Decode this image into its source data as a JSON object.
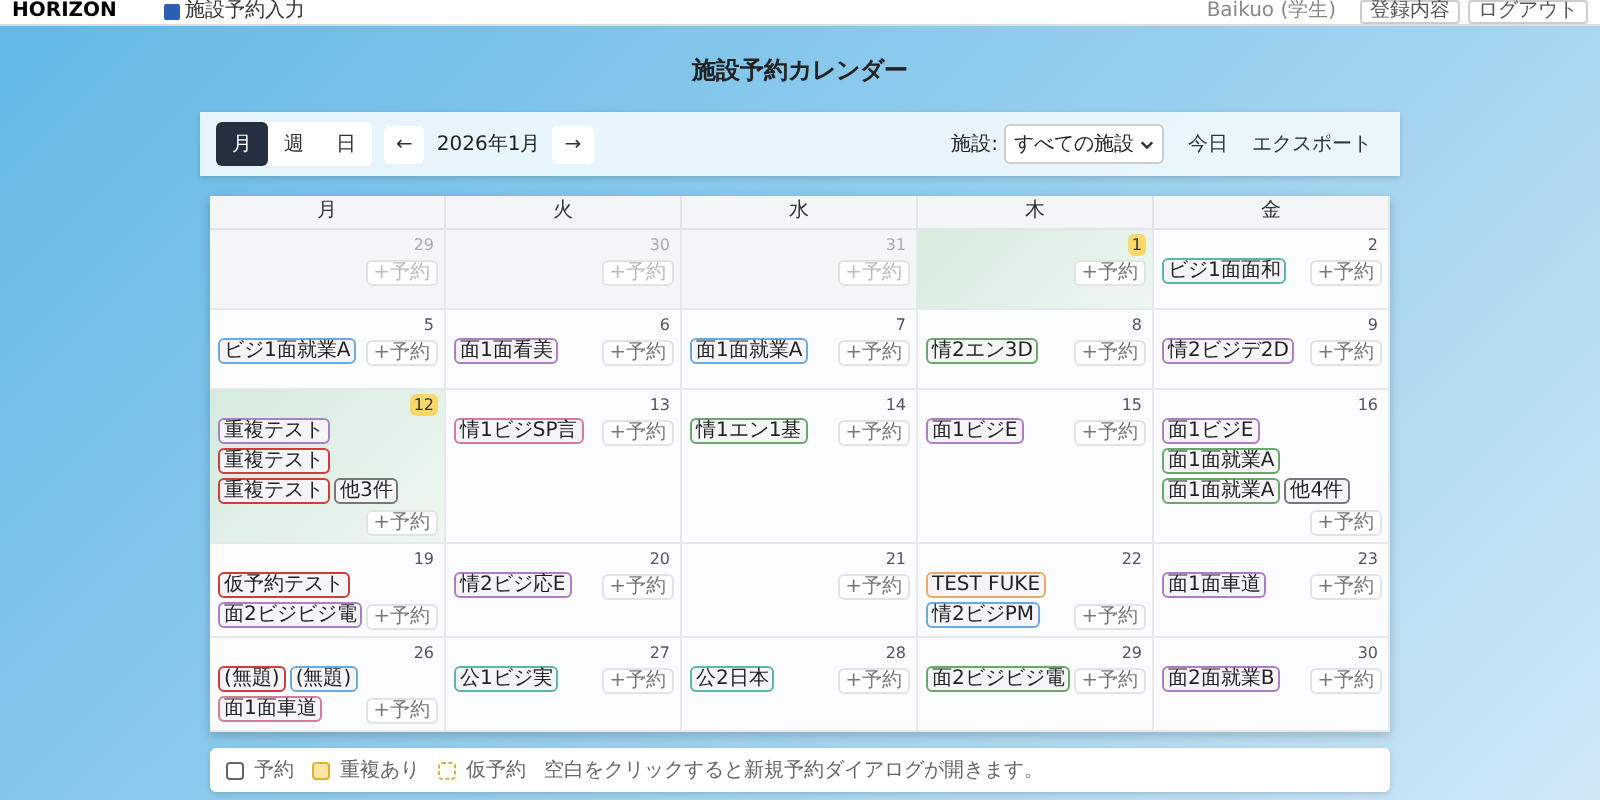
{
  "header": {
    "logo": "HORIZON",
    "nav": "施設予約入力",
    "user": "Baikuo (学生)",
    "buttons": [
      "登録内容",
      "ログアウト"
    ]
  },
  "title": "施設予約カレンダー",
  "toolbar": {
    "views": [
      {
        "label": "月",
        "selected": true
      },
      {
        "label": "週",
        "selected": false
      },
      {
        "label": "日",
        "selected": false
      }
    ],
    "prev": "←",
    "month": "2026年1月",
    "next": "→",
    "facility_label": "施設:",
    "facility": "すべての施設",
    "today": "今日",
    "export": "エクスポート"
  },
  "weekdays": [
    "月",
    "火",
    "水",
    "木",
    "金"
  ],
  "weeks": [
    {
      "days": [
        {
          "date": "29",
          "outside": true,
          "today": false,
          "add": "+予約"
        },
        {
          "date": "30",
          "outside": true,
          "today": false,
          "add": "+予約"
        },
        {
          "date": "31",
          "outside": true,
          "today": false,
          "add": "+予約"
        },
        {
          "date": "1",
          "outside": false,
          "today": true,
          "add": "+予約"
        },
        {
          "date": "2",
          "outside": false,
          "today": false,
          "add": "+予約",
          "events": [
            {
              "title": "ビジ1面面和",
              "color": "#5bb5a8"
            }
          ]
        }
      ]
    },
    {
      "days": [
        {
          "date": "5",
          "outside": false,
          "today": false,
          "add": "+予約",
          "events": [
            {
              "title": "ビジ1面就業A",
              "color": "#6fa8dc"
            }
          ]
        },
        {
          "date": "6",
          "outside": false,
          "today": false,
          "add": "+予約",
          "events": [
            {
              "title": "面1面看美",
              "color": "#b07cc6"
            }
          ]
        },
        {
          "date": "7",
          "outside": false,
          "today": false,
          "add": "+予約",
          "events": [
            {
              "title": "面1面就業A",
              "color": "#6fa8dc"
            }
          ]
        },
        {
          "date": "8",
          "outside": false,
          "today": false,
          "add": "+予約",
          "events": [
            {
              "title": "情2エン3D",
              "color": "#6aa86a"
            }
          ]
        },
        {
          "date": "9",
          "outside": false,
          "today": false,
          "add": "+予約",
          "events": [
            {
              "title": "情2ビジデ2D",
              "color": "#b07cc6"
            }
          ]
        }
      ]
    },
    {
      "days": [
        {
          "date": "12",
          "outside": false,
          "today": true,
          "add": "+予約",
          "events": [
            {
              "title": "重複テスト",
              "color": "#b07cc6"
            },
            {
              "title": "重複テスト",
              "color": "#d33a3a"
            },
            {
              "title": "重複テスト",
              "color": "#d33a3a"
            },
            {
              "title": "他3件",
              "color": "#777777"
            }
          ]
        },
        {
          "date": "13",
          "outside": false,
          "today": false,
          "add": "+予約",
          "events": [
            {
              "title": "情1ビジSP言",
              "color": "#d67a9a"
            }
          ]
        },
        {
          "date": "14",
          "outside": false,
          "today": false,
          "add": "+予約",
          "events": [
            {
              "title": "情1エン1基",
              "color": "#6aa86a"
            }
          ]
        },
        {
          "date": "15",
          "outside": false,
          "today": false,
          "add": "+予約",
          "events": [
            {
              "title": "面1ビジE",
              "color": "#b07cc6"
            }
          ]
        },
        {
          "date": "16",
          "outside": false,
          "today": false,
          "add": "+予約",
          "events": [
            {
              "title": "面1ビジE",
              "color": "#b07cc6"
            },
            {
              "title": "面1面就業A",
              "color": "#6aa86a"
            },
            {
              "title": "面1面就業A",
              "color": "#6aa86a"
            },
            {
              "title": "他4件",
              "color": "#777777"
            }
          ]
        }
      ]
    },
    {
      "days": [
        {
          "date": "19",
          "outside": false,
          "today": false,
          "add": "+予約",
          "events": [
            {
              "title": "仮予約テスト",
              "color": "#d33a3a"
            },
            {
              "title": "面2ビジビジ電",
              "color": "#b07cc6"
            }
          ]
        },
        {
          "date": "20",
          "outside": false,
          "today": false,
          "add": "+予約",
          "events": [
            {
              "title": "情2ビジ応E",
              "color": "#b07cc6"
            }
          ]
        },
        {
          "date": "21",
          "outside": false,
          "today": false,
          "add": "+予約"
        },
        {
          "date": "22",
          "outside": false,
          "today": false,
          "add": "+予約",
          "events": [
            {
              "title": "TEST FUKE",
              "color": "#f0a860"
            },
            {
              "title": "情2ビジPM",
              "color": "#6fa8dc"
            }
          ]
        },
        {
          "date": "23",
          "outside": false,
          "today": false,
          "add": "+予約",
          "events": [
            {
              "title": "面1面車道",
              "color": "#b07cc6"
            }
          ]
        }
      ]
    },
    {
      "days": [
        {
          "date": "26",
          "outside": false,
          "today": false,
          "add": "+予約",
          "events": [
            {
              "title": "(無題)",
              "color": "#d33a3a"
            },
            {
              "title": "(無題)",
              "color": "#6fa8dc"
            },
            {
              "title": "面1面車道",
              "color": "#d67a9a"
            }
          ]
        },
        {
          "date": "27",
          "outside": false,
          "today": false,
          "add": "+予約",
          "events": [
            {
              "title": "公1ビジ実",
              "color": "#5bb5a8"
            }
          ]
        },
        {
          "date": "28",
          "outside": false,
          "today": false,
          "add": "+予約",
          "events": [
            {
              "title": "公2日本",
              "color": "#5bb5a8"
            }
          ]
        },
        {
          "date": "29",
          "outside": false,
          "today": false,
          "add": "+予約",
          "events": [
            {
              "title": "面2ビジビジ電",
              "color": "#6aa86a"
            }
          ]
        },
        {
          "date": "30",
          "outside": false,
          "today": false,
          "add": "+予約",
          "events": [
            {
              "title": "面2面就業B",
              "color": "#b07cc6"
            }
          ]
        }
      ]
    }
  ],
  "legend": {
    "items": [
      {
        "kind": "normal",
        "label": "予約"
      },
      {
        "kind": "conflict",
        "label": "重複あり"
      },
      {
        "kind": "tentative",
        "label": "仮予約"
      }
    ],
    "hint": "空白をクリックすると新規予約ダイアログが開きます。"
  }
}
